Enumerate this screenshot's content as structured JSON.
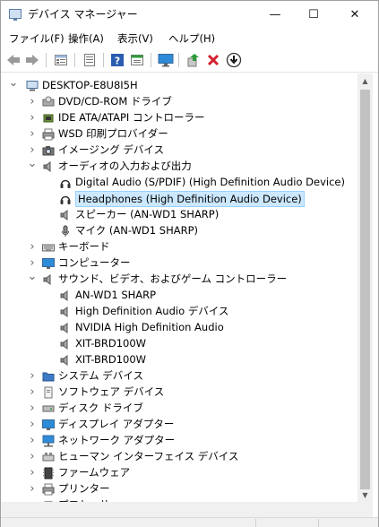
{
  "window": {
    "title": "デバイス マネージャー",
    "minimize_glyph": "—",
    "maximize_glyph": "☐",
    "close_glyph": "✕"
  },
  "menu": [
    {
      "label": "ファイル(F)"
    },
    {
      "label": "操作(A)"
    },
    {
      "label": "表示(V)"
    },
    {
      "label": "ヘルプ(H)"
    }
  ],
  "toolbar": {
    "icons": [
      "back-arrow-icon",
      "forward-arrow-icon",
      "properties-icon",
      "grid-list-icon",
      "help-icon",
      "sheet-icon",
      "monitor-scan-icon",
      "update-driver-icon",
      "remove-device-icon",
      "download-icon"
    ],
    "accent_red": "#d3202f",
    "accent_green": "#2f9a3a",
    "accent_blue": "#2a5db0"
  },
  "tree": [
    {
      "label": "DESKTOP-E8U8I5H",
      "depth": 0,
      "state": "expanded",
      "icon": "computer-icon"
    },
    {
      "label": "DVD/CD-ROM ドライブ",
      "depth": 1,
      "state": "collapsed",
      "icon": "disc-drive-icon"
    },
    {
      "label": "IDE ATA/ATAPI コントローラー",
      "depth": 1,
      "state": "collapsed",
      "icon": "ide-controller-icon"
    },
    {
      "label": "WSD 印刷プロバイダー",
      "depth": 1,
      "state": "collapsed",
      "icon": "printer-icon"
    },
    {
      "label": "イメージング デバイス",
      "depth": 1,
      "state": "collapsed",
      "icon": "camera-icon"
    },
    {
      "label": "オーディオの入力および出力",
      "depth": 1,
      "state": "expanded",
      "icon": "speaker-icon"
    },
    {
      "label": "Digital Audio (S/PDIF) (High Definition Audio Device)",
      "depth": 2,
      "state": "leaf",
      "icon": "headphones-icon"
    },
    {
      "label": "Headphones (High Definition Audio Device)",
      "depth": 2,
      "state": "leaf",
      "icon": "headphones-icon",
      "selected": true
    },
    {
      "label": "スピーカー (AN-WD1 SHARP)",
      "depth": 2,
      "state": "leaf",
      "icon": "speaker-icon"
    },
    {
      "label": "マイク (AN-WD1 SHARP)",
      "depth": 2,
      "state": "leaf",
      "icon": "microphone-icon"
    },
    {
      "label": "キーボード",
      "depth": 1,
      "state": "collapsed",
      "icon": "keyboard-icon"
    },
    {
      "label": "コンピューター",
      "depth": 1,
      "state": "collapsed",
      "icon": "monitor-icon"
    },
    {
      "label": "サウンド、ビデオ、およびゲーム コントローラー",
      "depth": 1,
      "state": "expanded",
      "icon": "speaker-icon"
    },
    {
      "label": "AN-WD1 SHARP",
      "depth": 2,
      "state": "leaf",
      "icon": "speaker-icon"
    },
    {
      "label": "High Definition Audio デバイス",
      "depth": 2,
      "state": "leaf",
      "icon": "speaker-icon"
    },
    {
      "label": "NVIDIA High Definition Audio",
      "depth": 2,
      "state": "leaf",
      "icon": "speaker-icon"
    },
    {
      "label": "XIT-BRD100W",
      "depth": 2,
      "state": "leaf",
      "icon": "speaker-icon"
    },
    {
      "label": "XIT-BRD100W",
      "depth": 2,
      "state": "leaf",
      "icon": "speaker-icon"
    },
    {
      "label": "システム デバイス",
      "depth": 1,
      "state": "collapsed",
      "icon": "system-folder-icon"
    },
    {
      "label": "ソフトウェア デバイス",
      "depth": 1,
      "state": "collapsed",
      "icon": "software-device-icon"
    },
    {
      "label": "ディスク ドライブ",
      "depth": 1,
      "state": "collapsed",
      "icon": "disk-drive-icon"
    },
    {
      "label": "ディスプレイ アダプター",
      "depth": 1,
      "state": "collapsed",
      "icon": "display-adapter-icon"
    },
    {
      "label": "ネットワーク アダプター",
      "depth": 1,
      "state": "collapsed",
      "icon": "network-icon"
    },
    {
      "label": "ヒューマン インターフェイス デバイス",
      "depth": 1,
      "state": "collapsed",
      "icon": "hid-icon"
    },
    {
      "label": "ファームウェア",
      "depth": 1,
      "state": "collapsed",
      "icon": "firmware-icon"
    },
    {
      "label": "プリンター",
      "depth": 1,
      "state": "collapsed",
      "icon": "printer-icon"
    },
    {
      "label": "プロセッサ",
      "depth": 1,
      "state": "collapsed",
      "icon": "processor-icon"
    }
  ],
  "colors": {
    "selection_bg": "#cce8ff",
    "selection_border": "#99d1ff",
    "monitor_blue": "#2e8bd8"
  }
}
